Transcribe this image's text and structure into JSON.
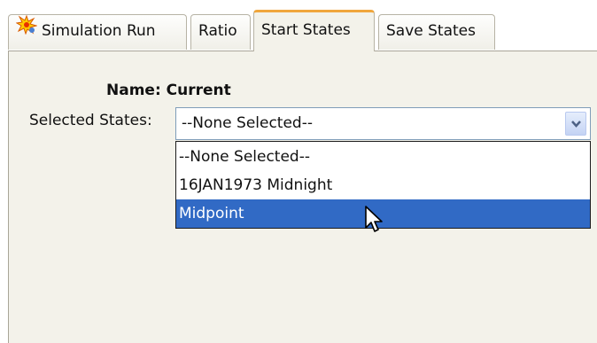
{
  "tabs": [
    {
      "label": "Simulation Run",
      "icon": "simulation-run-icon"
    },
    {
      "label": "Ratio"
    },
    {
      "label": "Start States",
      "active": true
    },
    {
      "label": "Save States"
    }
  ],
  "form": {
    "name_label": "Name:",
    "name_value": "Current",
    "states_label": "Selected States:",
    "combo_value": "--None Selected--"
  },
  "dropdown": {
    "options": [
      "--None Selected--",
      "16JAN1973 Midnight",
      "Midpoint"
    ],
    "highlighted_index": 2
  },
  "colors": {
    "active_tab_accent": "#f0a63c",
    "selection": "#316ac5",
    "panel_bg": "#f3f2ea"
  }
}
